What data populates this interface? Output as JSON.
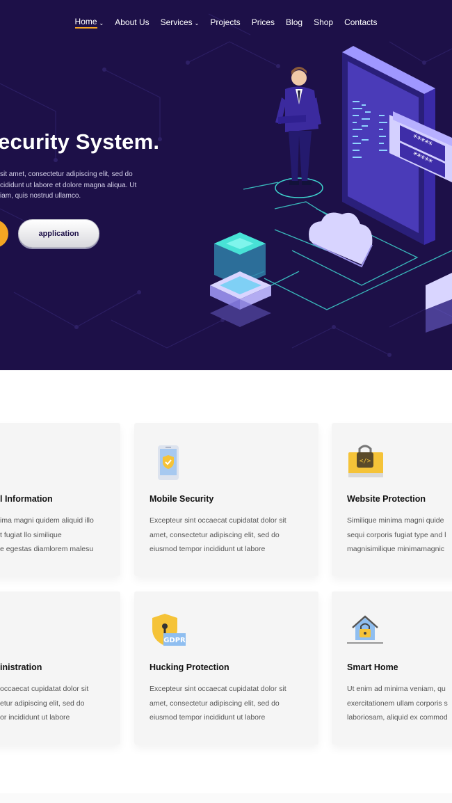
{
  "nav": {
    "items": [
      {
        "label": "Home",
        "active": true,
        "dropdown": true
      },
      {
        "label": "About Us",
        "active": false,
        "dropdown": false
      },
      {
        "label": "Services",
        "active": false,
        "dropdown": true
      },
      {
        "label": "Projects",
        "active": false,
        "dropdown": false
      },
      {
        "label": "Prices",
        "active": false,
        "dropdown": false
      },
      {
        "label": "Blog",
        "active": false,
        "dropdown": false
      },
      {
        "label": "Shop",
        "active": false,
        "dropdown": false
      },
      {
        "label": "Contacts",
        "active": false,
        "dropdown": false
      }
    ],
    "chevron": "⌄"
  },
  "hero": {
    "headline": "ecurity System.",
    "text_lines": [
      "sit amet, consectetur adipiscing elit, sed do",
      "cididunt ut labore et dolore magna aliqua. Ut",
      "iam, quis nostrud ullamco."
    ],
    "button_app": "application",
    "colors": {
      "bg": "#1d1048",
      "accent": "#f5a623",
      "circuit": "#3fd6d0"
    }
  },
  "services": [
    {
      "title": "l Information",
      "icon": "info-icon",
      "lines": [
        "ima magni quidem aliquid illo",
        "t fugiat llo similique",
        "e egestas diamlorem malesu"
      ]
    },
    {
      "title": "Mobile Security",
      "icon": "mobile-shield-icon",
      "lines": [
        "Excepteur sint occaecat cupidatat dolor sit",
        "amet, consectetur adipiscing elit, sed do",
        "eiusmod tempor incididunt ut labore"
      ]
    },
    {
      "title": "Website Protection",
      "icon": "monitor-lock-code-icon",
      "lines": [
        "Similique minima magni quide",
        "sequi corporis fugiat type and l",
        "magnisimilique minimamagnic"
      ]
    },
    {
      "title": "inistration",
      "icon": "admin-icon",
      "lines": [
        "occaecat cupidatat dolor sit",
        "etur adipiscing elit, sed do",
        "or incididunt ut labore"
      ]
    },
    {
      "title": "Hucking Protection",
      "icon": "gdpr-shield-icon",
      "badge": "GDPR",
      "lines": [
        "Excepteur sint occaecat cupidatat dolor sit",
        "amet, consectetur adipiscing elit, sed do",
        "eiusmod tempor incididunt ut labore"
      ]
    },
    {
      "title": "Smart Home",
      "icon": "smart-home-lock-icon",
      "lines": [
        "Ut enim ad minima veniam, qu",
        "exercitationem ullam corporis s",
        "laboriosam, aliquid ex commod"
      ]
    }
  ]
}
